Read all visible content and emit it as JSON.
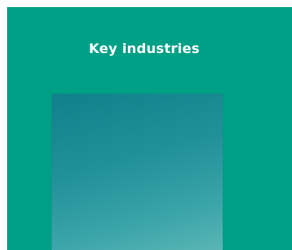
{
  "section": {
    "heading": "Key industries"
  },
  "colors": {
    "background": "#00a086",
    "card_gradient_start": "#10808a",
    "card_gradient_end": "#5ab5b5",
    "heading_text": "#ffffff"
  }
}
